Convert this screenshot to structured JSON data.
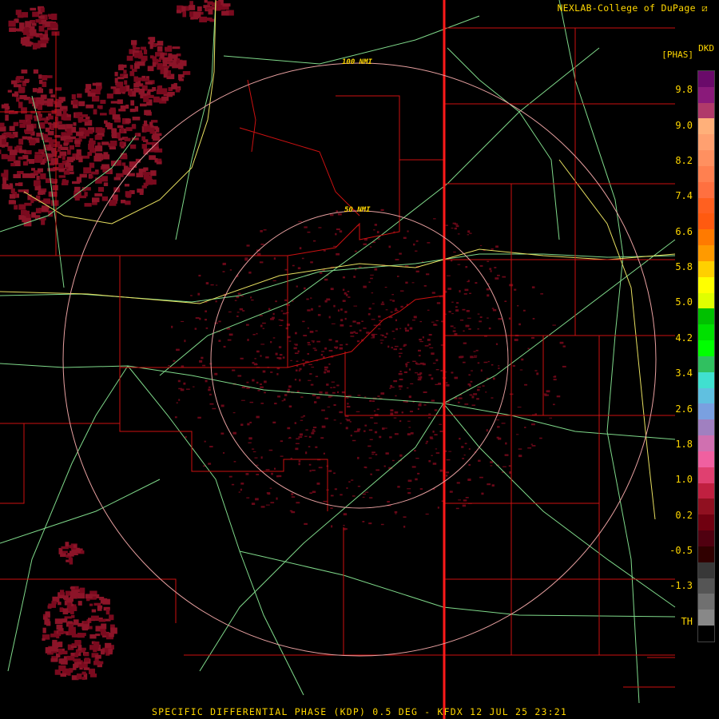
{
  "credit": "NEXLAB-College of DuPage",
  "product_code": "DKD",
  "units": "[PHAS]",
  "range_rings": [
    "100 NMI",
    "50 NMI"
  ],
  "footer": "SPECIFIC DIFFERENTIAL PHASE (KDP) 0.5 DEG - KFDX 12 JUL 25 23:21",
  "colorbar": {
    "labels": [
      "9.8",
      "9.0",
      "8.2",
      "7.4",
      "6.6",
      "5.8",
      "5.0",
      "4.2",
      "3.4",
      "2.6",
      "1.8",
      "1.0",
      "0.2",
      "-0.5",
      "-1.3",
      "TH"
    ],
    "colors": [
      "#6a0a6a",
      "#8a1a7a",
      "#b03a6a",
      "#ffb07a",
      "#ffa070",
      "#ff9060",
      "#ff8050",
      "#ff7040",
      "#ff6020",
      "#ff5a10",
      "#ff7a00",
      "#ff9a00",
      "#ffd000",
      "#ffff00",
      "#e0ff00",
      "#00c000",
      "#00e000",
      "#00ff00",
      "#30c060",
      "#40e0d0",
      "#60c0e0",
      "#7aa0e0",
      "#a080c0",
      "#d070b0",
      "#f060a0",
      "#e04070",
      "#c02040",
      "#901020",
      "#700010",
      "#500010",
      "#300000",
      "#383838",
      "#555555",
      "#707070",
      "#888888",
      "#000000"
    ]
  },
  "colors": {
    "boundary": "#cc1111",
    "road": "#7fd98a",
    "ring": "#e8a0a0",
    "text": "#ffd700",
    "echo": "#7a0a1e"
  }
}
